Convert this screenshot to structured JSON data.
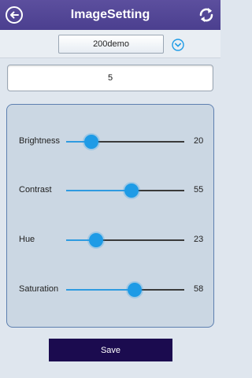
{
  "header": {
    "title": "ImageSetting",
    "back_icon": "back-arrow-icon",
    "refresh_icon": "refresh-icon"
  },
  "selector": {
    "selected": "200demo",
    "dropdown_icon": "chevron-down-icon"
  },
  "value_field": {
    "value": "5"
  },
  "sliders": [
    {
      "label": "Brightness",
      "value": "20",
      "level": 0.21
    },
    {
      "label": "Contrast",
      "value": "55",
      "level": 0.55
    },
    {
      "label": "Hue",
      "value": "23",
      "level": 0.25
    },
    {
      "label": "Saturation",
      "value": "58",
      "level": 0.58
    }
  ],
  "save_label": "Save",
  "colors": {
    "header": "#4b3f8f",
    "accent": "#1e9be6",
    "save_button": "#1b0b4f",
    "panel": "#cbd7e3"
  }
}
